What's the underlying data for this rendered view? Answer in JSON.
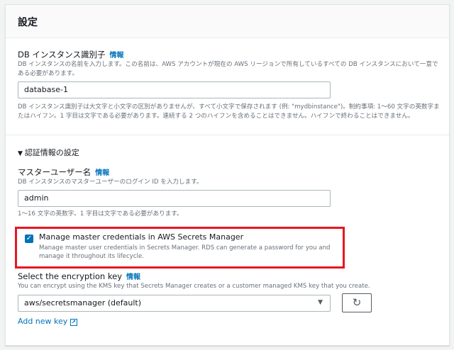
{
  "section_title": "設定",
  "info_label": "情報",
  "db_identifier": {
    "label": "DB インスタンス識別子",
    "description": "DB インスタンスの名前を入力します。この名前は、AWS アカウントが現在の AWS リージョンで所有しているすべての DB インスタンスにおいて一意である必要があります。",
    "value": "database-1",
    "constraint": "DB インスタンス識別子は大文字と小文字の区別がありませんが、すべて小文字で保存されます (例: \"mydbinstance\")。制約事項: 1〜60 文字の英数字またはハイフン。1 字目は文字である必要があります。連続する 2 つのハイフンを含めることはできません。ハイフンで終わることはできません。"
  },
  "credentials": {
    "section_label": "認証情報の設定",
    "master_user_label": "マスターユーザー名",
    "master_user_description": "DB インスタンスのマスターユーザーのログイン ID を入力します。",
    "master_user_value": "admin",
    "master_user_constraint": "1〜16 文字の英数字。1 字目は文字である必要があります。",
    "manage_checkbox_label": "Manage master credentials in AWS Secrets Manager",
    "manage_checkbox_checked": true,
    "manage_checkbox_description": "Manage master user credentials in Secrets Manager. RDS can generate a password for you and manage it throughout its lifecycle."
  },
  "encryption": {
    "label": "Select the encryption key",
    "description": "You can encrypt using the KMS key that Secrets Manager creates or a customer managed KMS key that you create.",
    "selected": "aws/secretsmanager (default)",
    "add_new_key": "Add new key"
  },
  "colors": {
    "link": "#0073bb",
    "highlight": "#e8161f"
  }
}
